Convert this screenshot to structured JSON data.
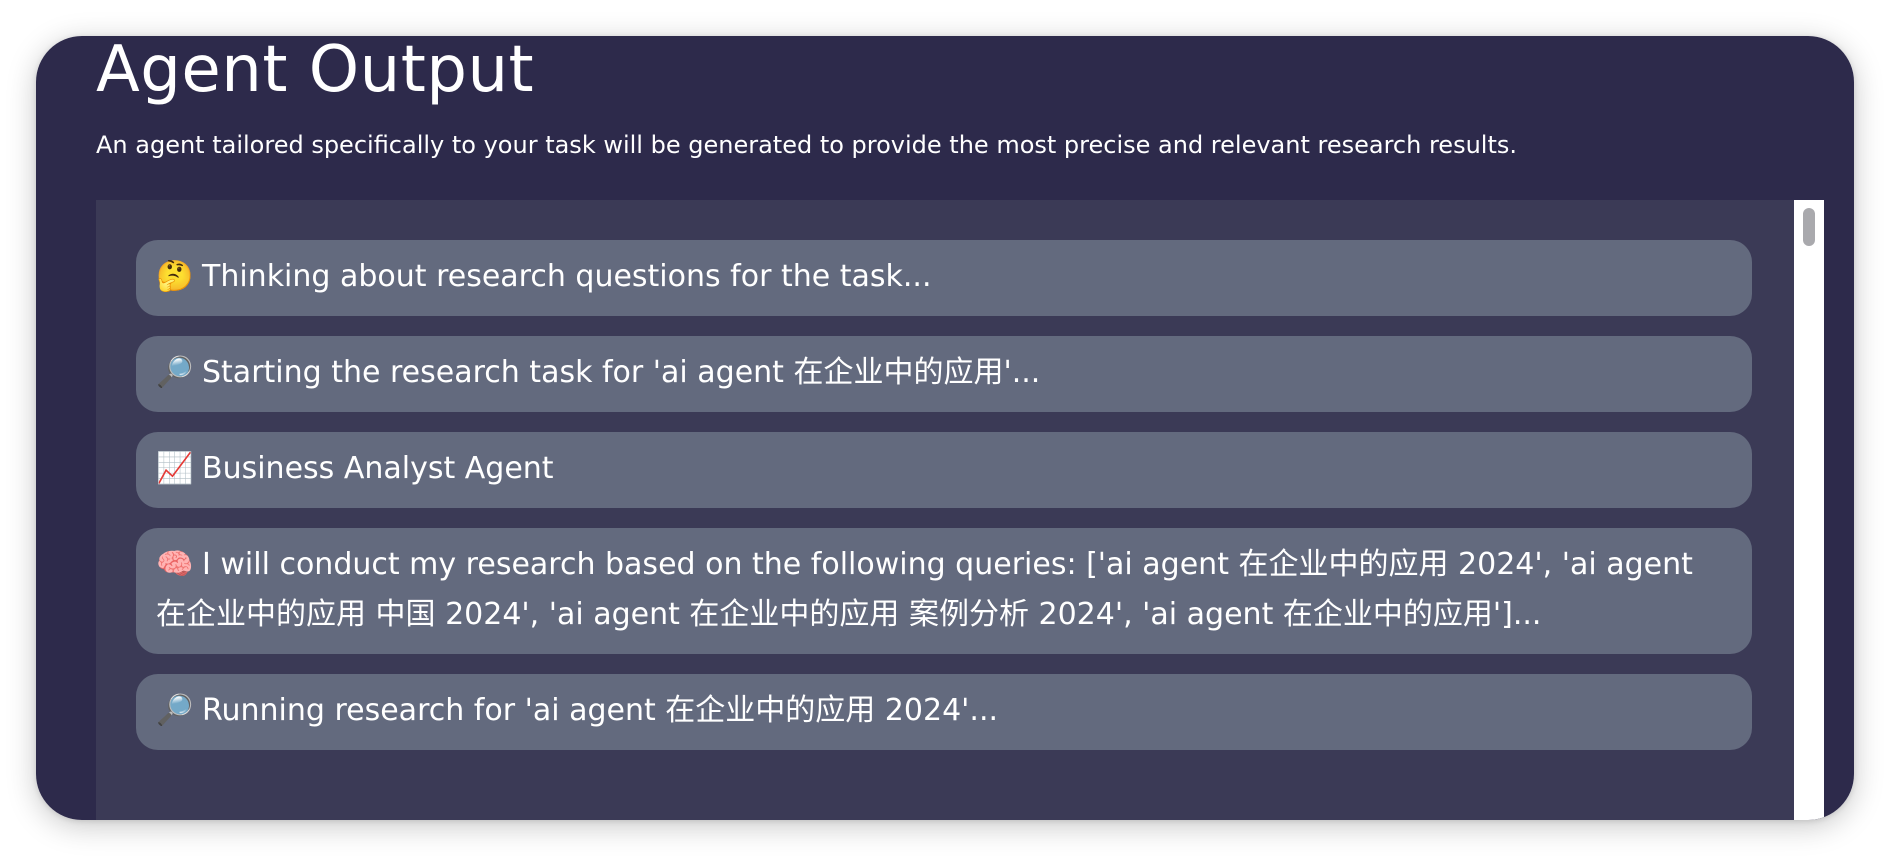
{
  "header": {
    "title": "Agent Output",
    "subtitle": "An agent tailored specifically to your task will be generated to provide the most precise and relevant research results."
  },
  "logs": [
    {
      "icon": "🤔",
      "icon_name": "thinking-face-icon",
      "text": "Thinking about research questions for the task..."
    },
    {
      "icon": "🔎",
      "icon_name": "magnifying-glass-icon",
      "text": "Starting the research task for 'ai agent 在企业中的应用'..."
    },
    {
      "icon": "📈",
      "icon_name": "chart-increasing-icon",
      "text": "Business Analyst Agent"
    },
    {
      "icon": "🧠",
      "icon_name": "brain-icon",
      "text": "I will conduct my research based on the following queries: ['ai agent 在企业中的应用 2024', 'ai agent 在企业中的应用 中国 2024', 'ai agent 在企业中的应用 案例分析 2024', 'ai agent 在企业中的应用']..."
    },
    {
      "icon": "🔎",
      "icon_name": "magnifying-glass-icon",
      "text": "Running research for 'ai agent 在企业中的应用 2024'..."
    }
  ],
  "colors": {
    "panel_background": "#2d2a4b",
    "output_background": "#3b3a56",
    "log_item_background": "#636a7e",
    "text": "#ffffff"
  }
}
